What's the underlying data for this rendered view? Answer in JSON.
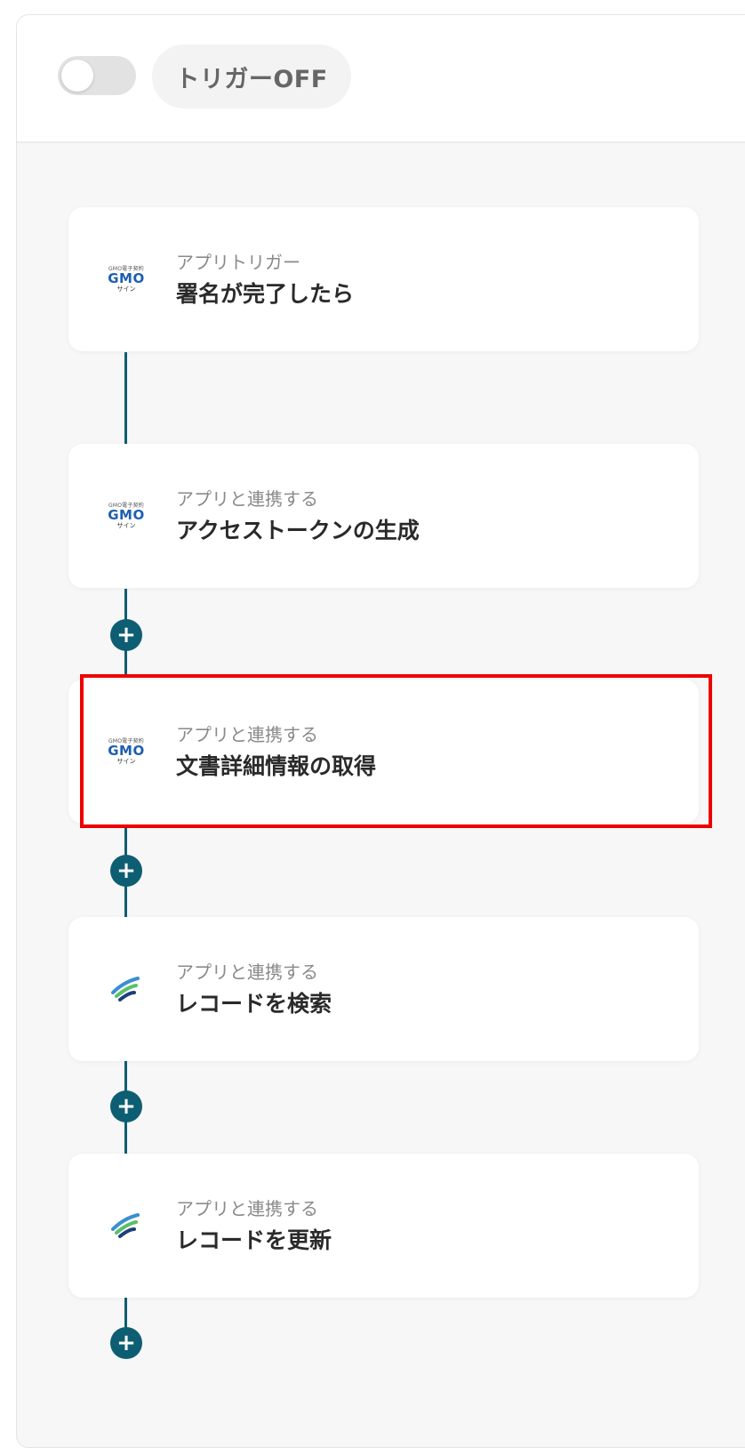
{
  "header": {
    "trigger_label": "トリガーOFF",
    "trigger_on": false
  },
  "flow": {
    "steps": [
      {
        "app": "GMOサイン",
        "icon": "gmo-sign-logo",
        "subtitle": "アプリトリガー",
        "title": "署名が完了したら",
        "logo_small_top": "GMO電子契約",
        "logo_main": "GMO",
        "logo_small_bottom": "サイン"
      },
      {
        "app": "GMOサイン",
        "icon": "gmo-sign-logo",
        "subtitle": "アプリと連携する",
        "title": "アクセストークンの生成",
        "logo_small_top": "GMO電子契約",
        "logo_main": "GMO",
        "logo_small_bottom": "サイン"
      },
      {
        "app": "GMOサイン",
        "icon": "gmo-sign-logo",
        "subtitle": "アプリと連携する",
        "title": "文書詳細情報の取得",
        "highlighted": true,
        "logo_small_top": "GMO電子契約",
        "logo_main": "GMO",
        "logo_small_bottom": "サイン"
      },
      {
        "app": "kintone-like",
        "icon": "swirl-logo",
        "subtitle": "アプリと連携する",
        "title": "レコードを検索"
      },
      {
        "app": "kintone-like",
        "icon": "swirl-logo",
        "subtitle": "アプリと連携する",
        "title": "レコードを更新"
      }
    ]
  },
  "add_step_symbol": "+",
  "colors": {
    "connector": "#0e5e73",
    "highlight": "#ee0000",
    "toggle_off": "#e2e2e2"
  }
}
